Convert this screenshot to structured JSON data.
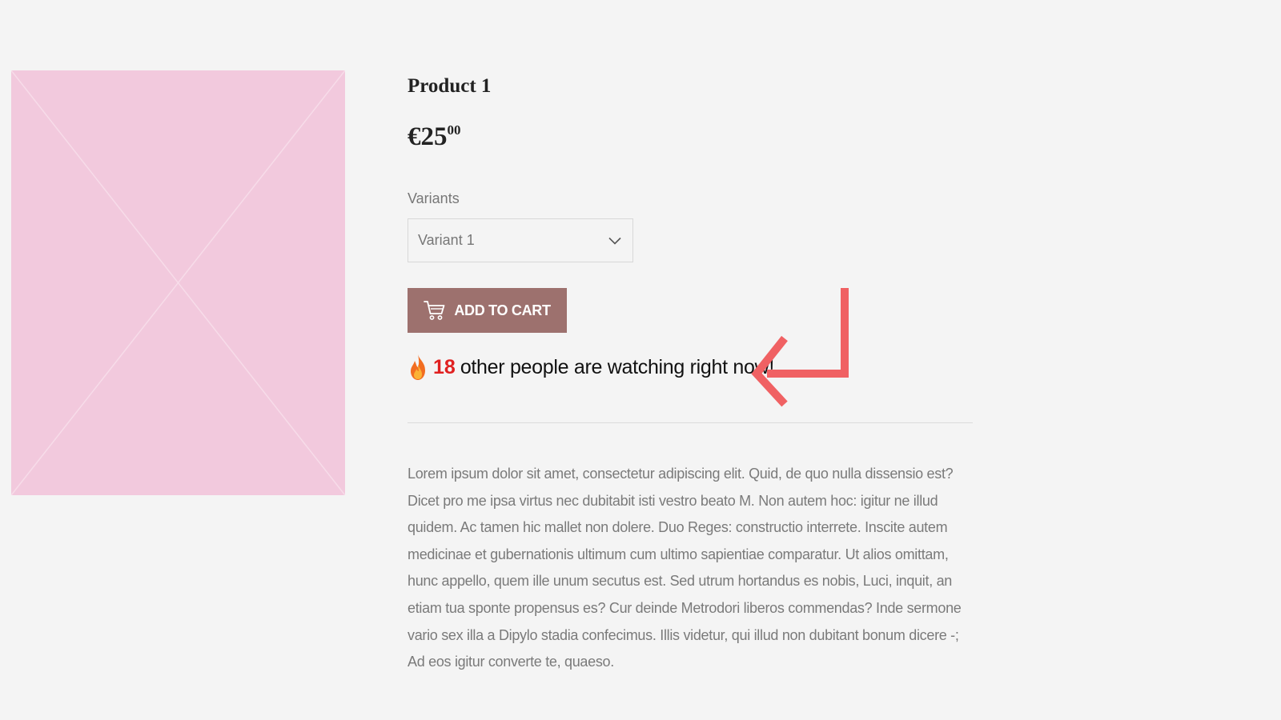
{
  "product": {
    "title": "Product 1",
    "price_main": "€25",
    "price_cents": "00",
    "image_color": "#f2c9dd"
  },
  "variants": {
    "label": "Variants",
    "selected": "Variant 1"
  },
  "cart_button": {
    "label": "ADD TO CART",
    "icon": "cart-icon",
    "color": "#9d716e"
  },
  "watchers": {
    "icon": "fire-icon",
    "count": "18",
    "text": "other people are watching right now!",
    "count_color": "#e02020"
  },
  "annotation": {
    "icon": "arrow-icon",
    "color": "#f06163"
  },
  "description": "Lorem ipsum dolor sit amet, consectetur adipiscing elit. Quid, de quo nulla dissensio est? Dicet pro me ipsa virtus nec dubitabit isti vestro beato M. Non autem hoc: igitur ne illud quidem. Ac tamen hic mallet non dolere. Duo Reges: constructio interrete. Inscite autem medicinae et gubernationis ultimum cum ultimo sapientiae comparatur. Ut alios omittam, hunc appello, quem ille unum secutus est. Sed utrum hortandus es nobis, Luci, inquit, an etiam tua sponte propensus es? Cur deinde Metrodori liberos commendas? Inde sermone vario sex illa a Dipylo stadia confecimus. Illis videtur, qui illud non dubitant bonum dicere -; Ad eos igitur converte te, quaeso."
}
